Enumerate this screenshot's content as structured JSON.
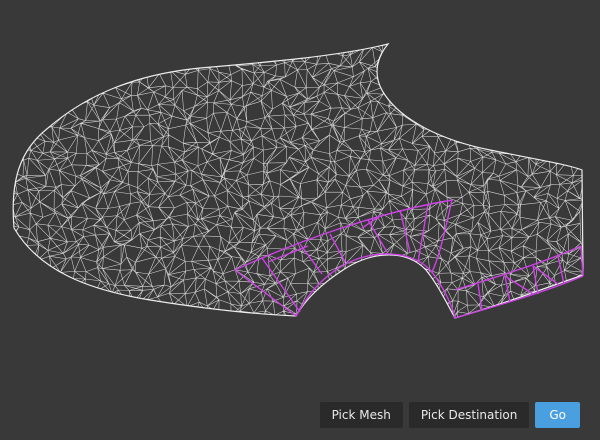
{
  "toolbar": {
    "pick_mesh_label": "Pick Mesh",
    "pick_destination_label": "Pick Destination",
    "go_label": "Go"
  },
  "colors": {
    "background": "#393939",
    "mesh_wire": "#ffffff",
    "selection": "#d040e8",
    "button_bg": "#2a2a2a",
    "accent": "#4a9fe0"
  }
}
